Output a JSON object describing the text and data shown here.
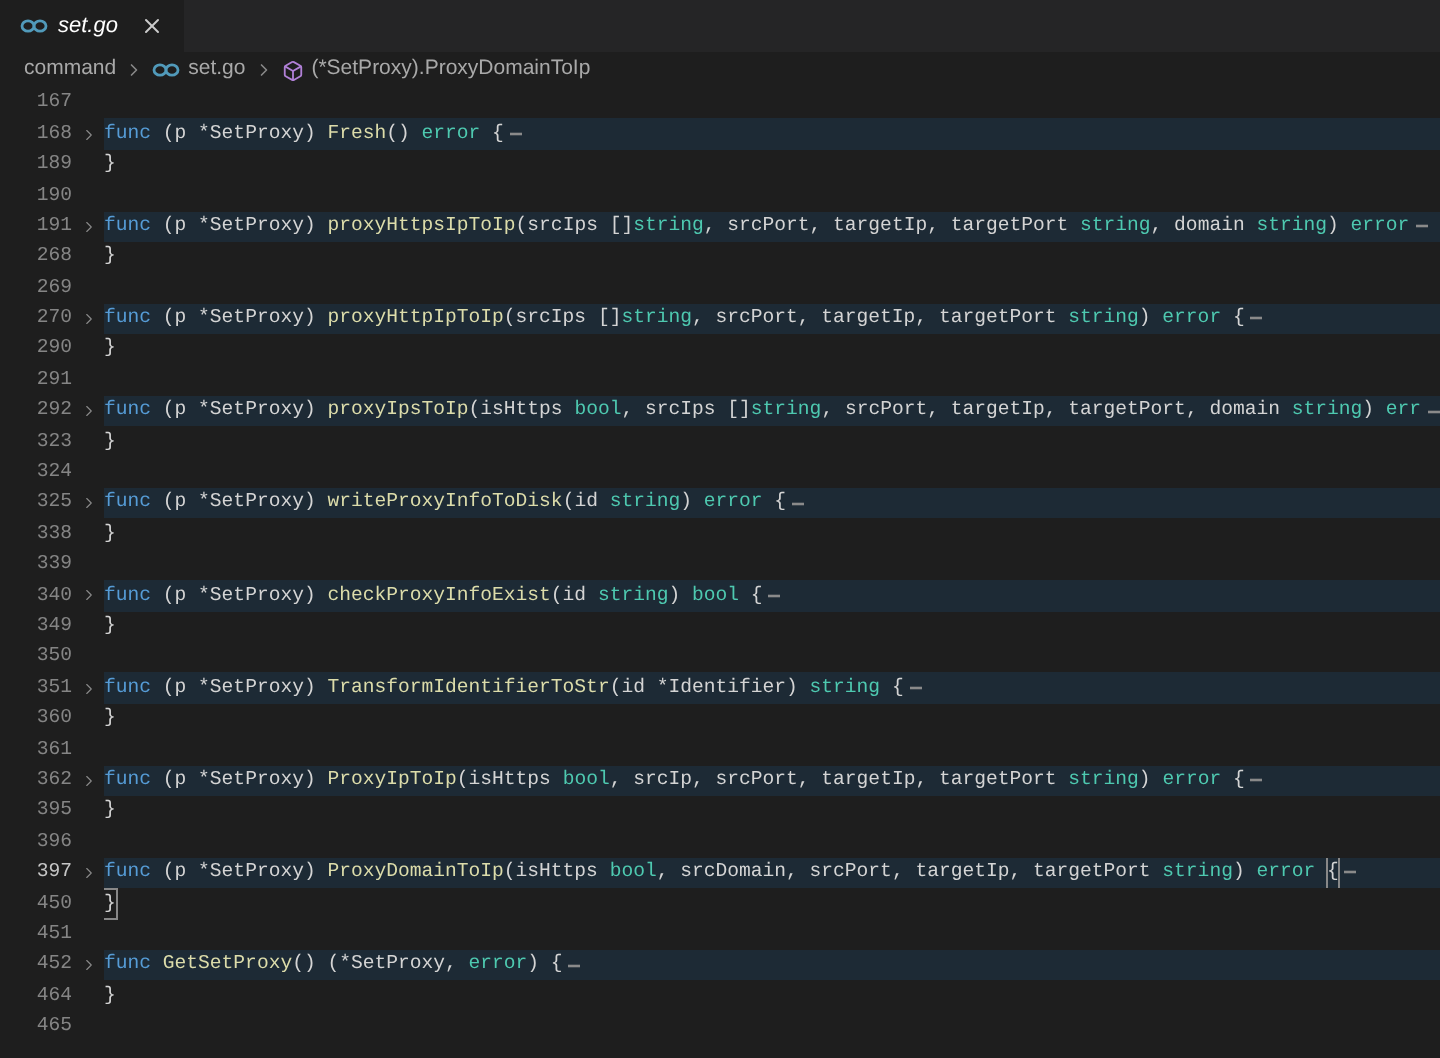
{
  "tabs": [
    {
      "label": "set.go",
      "selected": true,
      "preview": true
    }
  ],
  "breadcrumb": [
    "command",
    "set.go",
    "(*SetProxy).ProxyDomainToIp"
  ],
  "lines": [
    {
      "number": "167",
      "foldable": false,
      "folded": false,
      "current": false
    },
    {
      "number": "168",
      "foldable": true,
      "folded": true,
      "current": false,
      "tokens": [
        {
          "kind": "kw",
          "text": "func"
        },
        {
          "kind": "plain",
          "text": " (p *SetProxy) "
        },
        {
          "kind": "fn",
          "text": "Fresh"
        },
        {
          "kind": "plain",
          "text": "() "
        },
        {
          "kind": "type",
          "text": "error"
        },
        {
          "kind": "plain",
          "text": " {"
        }
      ]
    },
    {
      "number": "189",
      "foldable": false,
      "folded": false,
      "current": false,
      "tokens": [
        {
          "kind": "plain",
          "text": "}"
        }
      ]
    },
    {
      "number": "190",
      "foldable": false,
      "folded": false,
      "current": false
    },
    {
      "number": "191",
      "foldable": true,
      "folded": true,
      "current": false,
      "tokens": [
        {
          "kind": "kw",
          "text": "func"
        },
        {
          "kind": "plain",
          "text": " (p *SetProxy) "
        },
        {
          "kind": "fn",
          "text": "proxyHttpsIpToIp"
        },
        {
          "kind": "plain",
          "text": "(srcIps []"
        },
        {
          "kind": "type",
          "text": "string"
        },
        {
          "kind": "plain",
          "text": ", srcPort, targetIp, targetPort "
        },
        {
          "kind": "type",
          "text": "string"
        },
        {
          "kind": "plain",
          "text": ", domain "
        },
        {
          "kind": "type",
          "text": "string"
        },
        {
          "kind": "plain",
          "text": ") "
        },
        {
          "kind": "type",
          "text": "error"
        }
      ]
    },
    {
      "number": "268",
      "foldable": false,
      "folded": false,
      "current": false,
      "tokens": [
        {
          "kind": "plain",
          "text": "}"
        }
      ]
    },
    {
      "number": "269",
      "foldable": false,
      "folded": false,
      "current": false
    },
    {
      "number": "270",
      "foldable": true,
      "folded": true,
      "current": false,
      "tokens": [
        {
          "kind": "kw",
          "text": "func"
        },
        {
          "kind": "plain",
          "text": " (p *SetProxy) "
        },
        {
          "kind": "fn",
          "text": "proxyHttpIpToIp"
        },
        {
          "kind": "plain",
          "text": "(srcIps []"
        },
        {
          "kind": "type",
          "text": "string"
        },
        {
          "kind": "plain",
          "text": ", srcPort, targetIp, targetPort "
        },
        {
          "kind": "type",
          "text": "string"
        },
        {
          "kind": "plain",
          "text": ") "
        },
        {
          "kind": "type",
          "text": "error"
        },
        {
          "kind": "plain",
          "text": " {"
        }
      ]
    },
    {
      "number": "290",
      "foldable": false,
      "folded": false,
      "current": false,
      "tokens": [
        {
          "kind": "plain",
          "text": "}"
        }
      ]
    },
    {
      "number": "291",
      "foldable": false,
      "folded": false,
      "current": false
    },
    {
      "number": "292",
      "foldable": true,
      "folded": true,
      "current": false,
      "tokens": [
        {
          "kind": "kw",
          "text": "func"
        },
        {
          "kind": "plain",
          "text": " (p *SetProxy) "
        },
        {
          "kind": "fn",
          "text": "proxyIpsToIp"
        },
        {
          "kind": "plain",
          "text": "(isHttps "
        },
        {
          "kind": "type",
          "text": "bool"
        },
        {
          "kind": "plain",
          "text": ", srcIps []"
        },
        {
          "kind": "type",
          "text": "string"
        },
        {
          "kind": "plain",
          "text": ", srcPort, targetIp, targetPort, domain "
        },
        {
          "kind": "type",
          "text": "string"
        },
        {
          "kind": "plain",
          "text": ") "
        },
        {
          "kind": "type",
          "text": "err"
        }
      ]
    },
    {
      "number": "323",
      "foldable": false,
      "folded": false,
      "current": false,
      "tokens": [
        {
          "kind": "plain",
          "text": "}"
        }
      ]
    },
    {
      "number": "324",
      "foldable": false,
      "folded": false,
      "current": false
    },
    {
      "number": "325",
      "foldable": true,
      "folded": true,
      "current": false,
      "tokens": [
        {
          "kind": "kw",
          "text": "func"
        },
        {
          "kind": "plain",
          "text": " (p *SetProxy) "
        },
        {
          "kind": "fn",
          "text": "writeProxyInfoToDisk"
        },
        {
          "kind": "plain",
          "text": "(id "
        },
        {
          "kind": "type",
          "text": "string"
        },
        {
          "kind": "plain",
          "text": ") "
        },
        {
          "kind": "type",
          "text": "error"
        },
        {
          "kind": "plain",
          "text": " {"
        }
      ]
    },
    {
      "number": "338",
      "foldable": false,
      "folded": false,
      "current": false,
      "tokens": [
        {
          "kind": "plain",
          "text": "}"
        }
      ]
    },
    {
      "number": "339",
      "foldable": false,
      "folded": false,
      "current": false
    },
    {
      "number": "340",
      "foldable": true,
      "folded": true,
      "current": false,
      "tokens": [
        {
          "kind": "kw",
          "text": "func"
        },
        {
          "kind": "plain",
          "text": " (p *SetProxy) "
        },
        {
          "kind": "fn",
          "text": "checkProxyInfoExist"
        },
        {
          "kind": "plain",
          "text": "(id "
        },
        {
          "kind": "type",
          "text": "string"
        },
        {
          "kind": "plain",
          "text": ") "
        },
        {
          "kind": "type",
          "text": "bool"
        },
        {
          "kind": "plain",
          "text": " {"
        }
      ]
    },
    {
      "number": "349",
      "foldable": false,
      "folded": false,
      "current": false,
      "tokens": [
        {
          "kind": "plain",
          "text": "}"
        }
      ]
    },
    {
      "number": "350",
      "foldable": false,
      "folded": false,
      "current": false
    },
    {
      "number": "351",
      "foldable": true,
      "folded": true,
      "current": false,
      "tokens": [
        {
          "kind": "kw",
          "text": "func"
        },
        {
          "kind": "plain",
          "text": " (p *SetProxy) "
        },
        {
          "kind": "fn",
          "text": "TransformIdentifierToStr"
        },
        {
          "kind": "plain",
          "text": "(id *Identifier) "
        },
        {
          "kind": "type",
          "text": "string"
        },
        {
          "kind": "plain",
          "text": " {"
        }
      ]
    },
    {
      "number": "360",
      "foldable": false,
      "folded": false,
      "current": false,
      "tokens": [
        {
          "kind": "plain",
          "text": "}"
        }
      ]
    },
    {
      "number": "361",
      "foldable": false,
      "folded": false,
      "current": false
    },
    {
      "number": "362",
      "foldable": true,
      "folded": true,
      "current": false,
      "tokens": [
        {
          "kind": "kw",
          "text": "func"
        },
        {
          "kind": "plain",
          "text": " (p *SetProxy) "
        },
        {
          "kind": "fn",
          "text": "ProxyIpToIp"
        },
        {
          "kind": "plain",
          "text": "(isHttps "
        },
        {
          "kind": "type",
          "text": "bool"
        },
        {
          "kind": "plain",
          "text": ", srcIp, srcPort, targetIp, targetPort "
        },
        {
          "kind": "type",
          "text": "string"
        },
        {
          "kind": "plain",
          "text": ") "
        },
        {
          "kind": "type",
          "text": "error"
        },
        {
          "kind": "plain",
          "text": " {"
        }
      ]
    },
    {
      "number": "395",
      "foldable": false,
      "folded": false,
      "current": false,
      "tokens": [
        {
          "kind": "plain",
          "text": "}"
        }
      ]
    },
    {
      "number": "396",
      "foldable": false,
      "folded": false,
      "current": false
    },
    {
      "number": "397",
      "foldable": true,
      "folded": true,
      "current": true,
      "tokens": [
        {
          "kind": "kw",
          "text": "func"
        },
        {
          "kind": "plain",
          "text": " (p *SetProxy) "
        },
        {
          "kind": "fn",
          "text": "ProxyDomainToIp"
        },
        {
          "kind": "plain",
          "text": "(isHttps "
        },
        {
          "kind": "type",
          "text": "bool"
        },
        {
          "kind": "plain",
          "text": ", srcDomain, srcPort, targetIp, targetPort "
        },
        {
          "kind": "type",
          "text": "string"
        },
        {
          "kind": "plain",
          "text": ") "
        },
        {
          "kind": "type",
          "text": "error "
        },
        {
          "kind": "match",
          "text": "{"
        }
      ]
    },
    {
      "number": "450",
      "foldable": false,
      "folded": false,
      "current": false,
      "tokens": [
        {
          "kind": "match",
          "text": "}"
        }
      ]
    },
    {
      "number": "451",
      "foldable": false,
      "folded": false,
      "current": false
    },
    {
      "number": "452",
      "foldable": true,
      "folded": true,
      "current": false,
      "tokens": [
        {
          "kind": "kw",
          "text": "func "
        },
        {
          "kind": "fn",
          "text": "GetSetProxy"
        },
        {
          "kind": "plain",
          "text": "() (*SetProxy, "
        },
        {
          "kind": "type",
          "text": "error"
        },
        {
          "kind": "plain",
          "text": ") {"
        }
      ]
    },
    {
      "number": "464",
      "foldable": false,
      "folded": false,
      "current": false,
      "tokens": [
        {
          "kind": "plain",
          "text": "}"
        }
      ]
    },
    {
      "number": "465",
      "foldable": false,
      "folded": false,
      "current": false
    }
  ]
}
